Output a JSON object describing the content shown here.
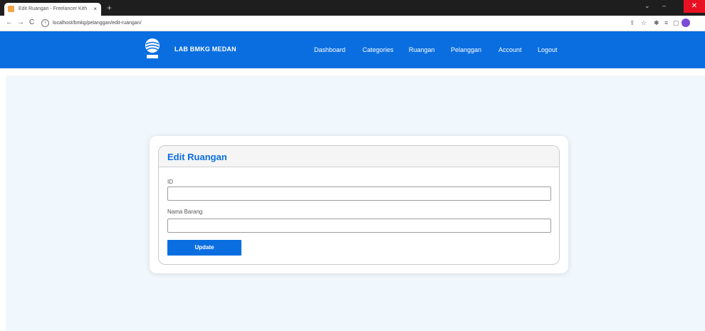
{
  "browser": {
    "tab_title": "Edit Ruangan - Freelancer Kith",
    "tab_close": "×",
    "new_tab": "+",
    "url": "localhost/bmkg/pelanggan/edit-ruangan/",
    "back": "←",
    "forward": "→",
    "reload": "C"
  },
  "navbar": {
    "brand": "LAB BMKG MEDAN",
    "items": [
      "Dashboard",
      "Categories",
      "Ruangan",
      "Pelanggan",
      "Account",
      "Logout"
    ]
  },
  "form": {
    "title": "Edit Ruangan",
    "fields": [
      {
        "label": "ID",
        "value": ""
      },
      {
        "label": "Nama Barang",
        "value": ""
      }
    ],
    "submit_label": "Update"
  },
  "colors": {
    "primary": "#0a6ee0",
    "page_bg": "#f1f8fd"
  }
}
